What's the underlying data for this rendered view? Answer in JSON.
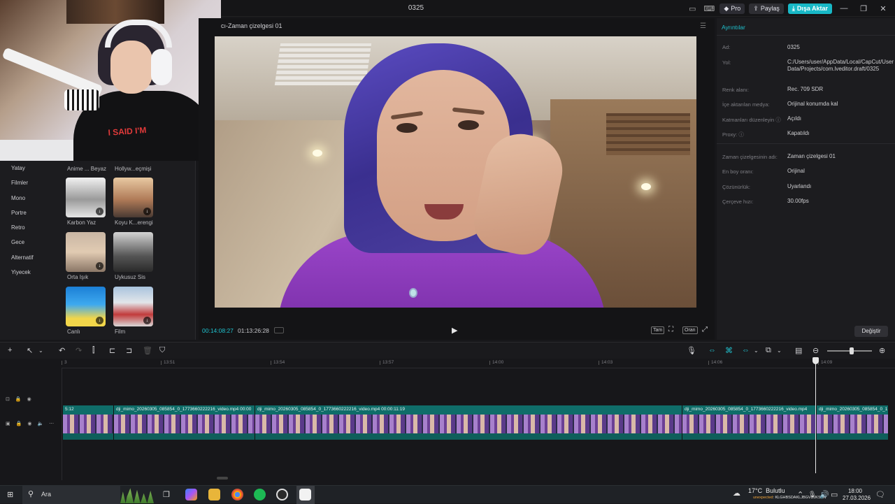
{
  "window": {
    "title": "0325",
    "pro_label": "Pro",
    "share_label": "Paylaş",
    "export_label": "Dışa Aktar"
  },
  "filters": {
    "categories": [
      "Yatay",
      "Filmler",
      "Mono",
      "Portre",
      "Retro",
      "Gece",
      "Alternatif",
      "Yiyecek"
    ],
    "items": [
      {
        "label": "Anime ... Beyaz"
      },
      {
        "label": "Hollyw...eçmişi"
      },
      {
        "label": "Karbon Yaz"
      },
      {
        "label": "Koyu K...erengi"
      },
      {
        "label": "Orta Işık"
      },
      {
        "label": "Uykusuz Sis"
      },
      {
        "label": "Canlı"
      },
      {
        "label": "Film"
      }
    ]
  },
  "preview": {
    "title": "cı-Zaman çizelgesi 01",
    "current_time": "00:14:08:27",
    "total_time": "01:13:26:28",
    "full_label": "Tam",
    "ratio_label": "Oran"
  },
  "details": {
    "heading": "Ayrıntılar",
    "rows": [
      {
        "label": "Ad:",
        "value": "0325"
      },
      {
        "label": "Yol:",
        "value": "C:/Users/user/AppData/Local/CapCut/User Data/Projects/com.lveditor.draft/0325"
      },
      {
        "label": "Renk alanı:",
        "value": "Rec. 709 SDR"
      },
      {
        "label": "İçe aktarılan medya:",
        "value": "Orijinal konumda kal"
      },
      {
        "label": "Katmanları düzenleyin ⓘ",
        "value": "Açıldı"
      },
      {
        "label": "Proxy: ⓘ",
        "value": "Kapatıldı"
      },
      {
        "label": "Zaman çizelgesinin adı:",
        "value": "Zaman çizelgesi 01"
      },
      {
        "label": "En boy oranı:",
        "value": "Orijinal"
      },
      {
        "label": "Çözünürlük:",
        "value": "Uyarlandı"
      },
      {
        "label": "Çerçeve hızı:",
        "value": "30.00fps"
      }
    ],
    "change_label": "Değiştir"
  },
  "timeline": {
    "ticks": [
      "3",
      "13:51",
      "13:54",
      "13:57",
      "14:00",
      "14:03",
      "14:06",
      "14:09"
    ],
    "clips": [
      {
        "name": "5:12"
      },
      {
        "name": "dji_mimo_20260305_085854_0_1773660222216_video.mp4   00:00"
      },
      {
        "name": "dji_mimo_20260305_085854_0_1773660222216_video.mp4   00:00:11:19"
      },
      {
        "name": "dji_mimo_20260305_085854_0_1773660222216_video.mp4"
      },
      {
        "name": "dji_mimo_20260305_085854_0_1"
      }
    ]
  },
  "taskbar": {
    "search_placeholder": "Ara",
    "weather_temp": "17°C",
    "weather_desc": "Bulutlu",
    "weather_sub_warn": "unexpected",
    "weather_sub_rest": ": KLGHBSDAKLJBGVDJKSAN",
    "time": "18:00",
    "date": "27.03.2026"
  }
}
